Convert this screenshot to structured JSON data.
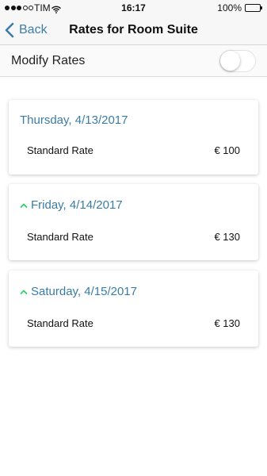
{
  "status_bar": {
    "carrier": "TIM",
    "time": "16:17",
    "battery": "100%",
    "signal_bars": [
      true,
      true,
      true,
      false,
      false
    ],
    "icons": [
      "signal-dots-icon",
      "wifi-icon",
      "battery-icon"
    ]
  },
  "nav": {
    "back_label": "Back",
    "title": "Rates for Room Suite",
    "accent_color": "#3d7ea6",
    "icons": [
      "chevron-left-icon"
    ]
  },
  "modify": {
    "label": "Modify Rates",
    "enabled": false
  },
  "days": [
    {
      "date": "Thursday, 4/13/2017",
      "indicator": "none",
      "rates": [
        {
          "name": "Standard Rate",
          "price": "€ 100"
        }
      ]
    },
    {
      "date": "Friday, 4/14/2017",
      "indicator": "up",
      "rates": [
        {
          "name": "Standard Rate",
          "price": "€ 130"
        }
      ]
    },
    {
      "date": "Saturday, 4/15/2017",
      "indicator": "up",
      "rates": [
        {
          "name": "Standard Rate",
          "price": "€ 130"
        }
      ]
    }
  ],
  "colors": {
    "date_text": "#3a7ca5",
    "increase_indicator": "#2ecc71"
  }
}
